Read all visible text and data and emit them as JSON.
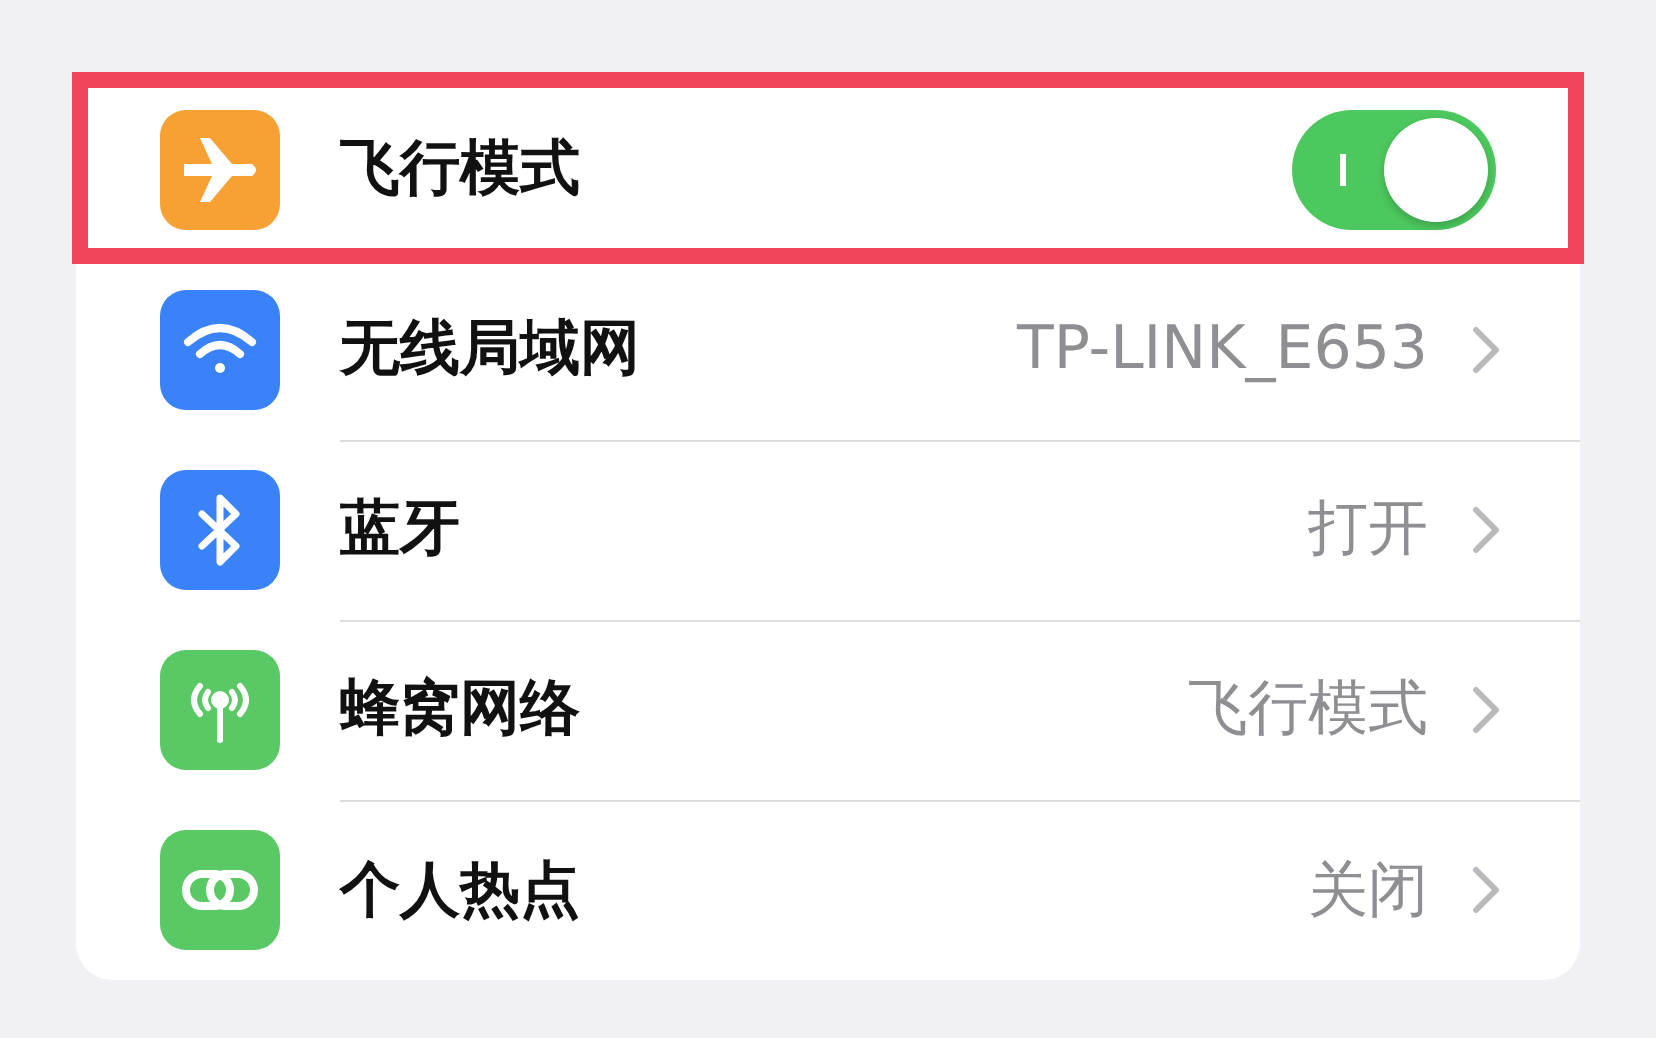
{
  "settings": [
    {
      "kind": "toggle",
      "label": "飞行模式",
      "color": "#f7a034",
      "on": true,
      "highlighted": true
    },
    {
      "kind": "link",
      "label": "无线局域网",
      "color": "#3a82f7",
      "value": "TP-LINK_E653",
      "highlighted": false
    },
    {
      "kind": "link",
      "label": "蓝牙",
      "color": "#3a82f7",
      "value": "打开",
      "highlighted": false
    },
    {
      "kind": "link",
      "label": "蜂窝网络",
      "color": "#5ac864",
      "value": "飞行模式",
      "highlighted": false
    },
    {
      "kind": "link",
      "label": "个人热点",
      "color": "#5ac864",
      "value": "关闭",
      "highlighted": false
    }
  ]
}
